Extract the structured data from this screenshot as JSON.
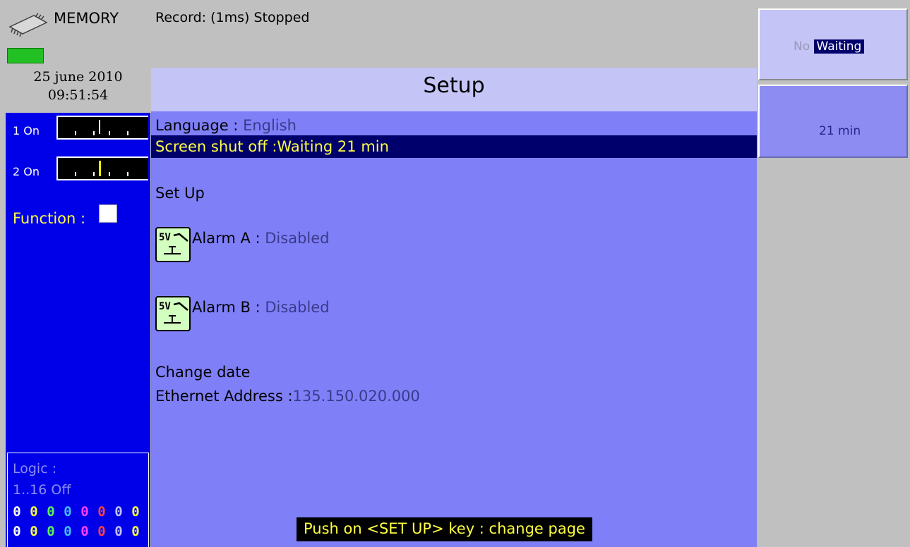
{
  "memory": {
    "label": "MEMORY"
  },
  "record": {
    "status": "Record: (1ms) Stopped"
  },
  "datetime": {
    "date": "25 june 2010",
    "time": "09:51:54"
  },
  "channels": [
    {
      "label": "1 On"
    },
    {
      "label": "2 On"
    }
  ],
  "function": {
    "label": "Function :"
  },
  "logic": {
    "label": "Logic :",
    "range": "1..16   Off",
    "row1": [
      "0",
      "0",
      "0",
      "0",
      "0",
      "0",
      "0",
      "0"
    ],
    "row2": [
      "0",
      "0",
      "0",
      "0",
      "0",
      "0",
      "0",
      "0"
    ],
    "row1_colors": [
      "#ffffff",
      "#ffff40",
      "#5cf25c",
      "#40c0ff",
      "#ff40ff",
      "#ff4040",
      "#c0c0ff",
      "#ffff40"
    ],
    "row2_colors": [
      "#ffffff",
      "#ffff40",
      "#5cf25c",
      "#40c0ff",
      "#ff40ff",
      "#ff4040",
      "#c0c0ff",
      "#ffff40"
    ]
  },
  "setup": {
    "title": "Setup",
    "language_label": "Language : ",
    "language_value": "English",
    "screen_shutoff": "Screen shut off :Waiting  21 min",
    "setup_label": "Set Up",
    "alarm_a_label": "Alarm A : ",
    "alarm_a_value": " Disabled",
    "alarm_b_label": "Alarm B : ",
    "alarm_b_value": " Disabled",
    "alarm_icon_text": "5V",
    "change_date": "Change date",
    "ethernet_label": "Ethernet Address :",
    "ethernet_value": "135.150.020.000"
  },
  "softkeys": {
    "key1_prefix": "No ",
    "key1_selected": "Waiting",
    "key2": "21 min"
  },
  "footer": {
    "hint": "Push on <SET UP> key : change page"
  },
  "colors": {
    "panel_blue": "#0000e8",
    "main_violet": "#7f7ff8",
    "header_lavender": "#c4c4f6",
    "selection_navy": "#00006c",
    "highlight_yellow": "#ffff40"
  }
}
